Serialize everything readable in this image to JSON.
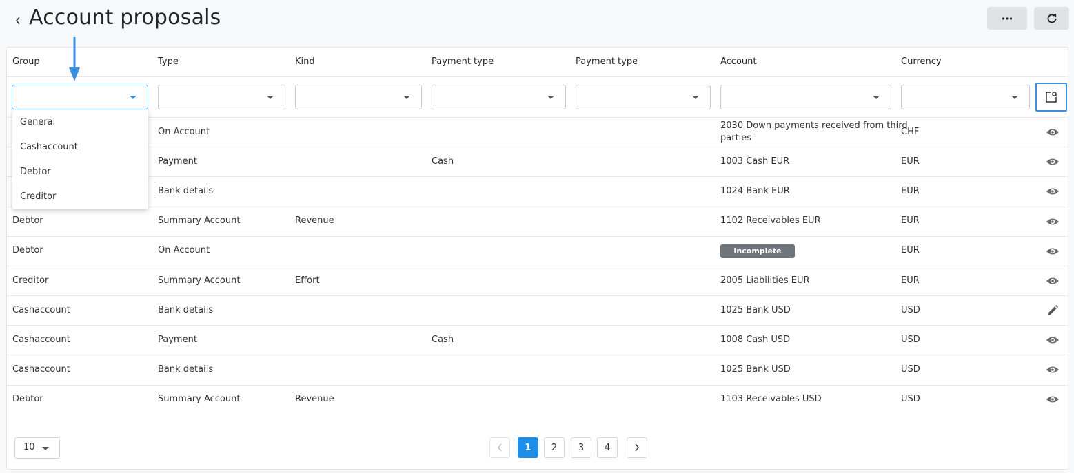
{
  "header": {
    "title": "Account proposals"
  },
  "columns": [
    "Group",
    "Type",
    "Kind",
    "Payment type",
    "Payment type",
    "Account",
    "Currency"
  ],
  "group_dropdown": {
    "options": [
      "General",
      "Cashaccount",
      "Debtor",
      "Creditor"
    ]
  },
  "rows": [
    {
      "group": "",
      "type": "On Account",
      "kind": "",
      "payment": "",
      "payment2": "",
      "account": "2030 Down payments received from third",
      "account_line2": "parties",
      "currency": "CHF",
      "action": "eye-icon"
    },
    {
      "group": "",
      "type": "Payment",
      "kind": "",
      "payment": "Cash",
      "payment2": "",
      "account": "1003 Cash EUR",
      "currency": "EUR",
      "action": "eye-icon"
    },
    {
      "group": "",
      "type": "Bank details",
      "kind": "",
      "payment": "",
      "payment2": "",
      "account": "1024 Bank EUR",
      "currency": "EUR",
      "action": "eye-icon"
    },
    {
      "group": "Debtor",
      "type": "Summary Account",
      "kind": "Revenue",
      "payment": "",
      "payment2": "",
      "account": "1102 Receivables EUR",
      "currency": "EUR",
      "action": "eye-icon"
    },
    {
      "group": "Debtor",
      "type": "On Account",
      "kind": "",
      "payment": "",
      "payment2": "",
      "account_badge": "Incomplete",
      "currency": "EUR",
      "action": "eye-icon"
    },
    {
      "group": "Creditor",
      "type": "Summary Account",
      "kind": "Effort",
      "payment": "",
      "payment2": "",
      "account": "2005 Liabilities EUR",
      "currency": "EUR",
      "action": "eye-icon"
    },
    {
      "group": "Cashaccount",
      "type": "Bank details",
      "kind": "",
      "payment": "",
      "payment2": "",
      "account": "1025 Bank USD",
      "currency": "USD",
      "action": "pencil-icon"
    },
    {
      "group": "Cashaccount",
      "type": "Payment",
      "kind": "",
      "payment": "Cash",
      "payment2": "",
      "account": "1008 Cash USD",
      "currency": "USD",
      "action": "eye-icon"
    },
    {
      "group": "Cashaccount",
      "type": "Bank details",
      "kind": "",
      "payment": "",
      "payment2": "",
      "account": "1025 Bank USD",
      "currency": "USD",
      "action": "eye-icon"
    },
    {
      "group": "Debtor",
      "type": "Summary Account",
      "kind": "Revenue",
      "payment": "",
      "payment2": "",
      "account": "1103 Receivables USD",
      "currency": "USD",
      "action": "eye-icon"
    }
  ],
  "pagination": {
    "page_size": "10",
    "pages": [
      "1",
      "2",
      "3",
      "4"
    ],
    "current": "1"
  },
  "colors": {
    "accent": "#1e8fe8",
    "badge": "#6e757c",
    "arrow": "#3a8fe0"
  }
}
